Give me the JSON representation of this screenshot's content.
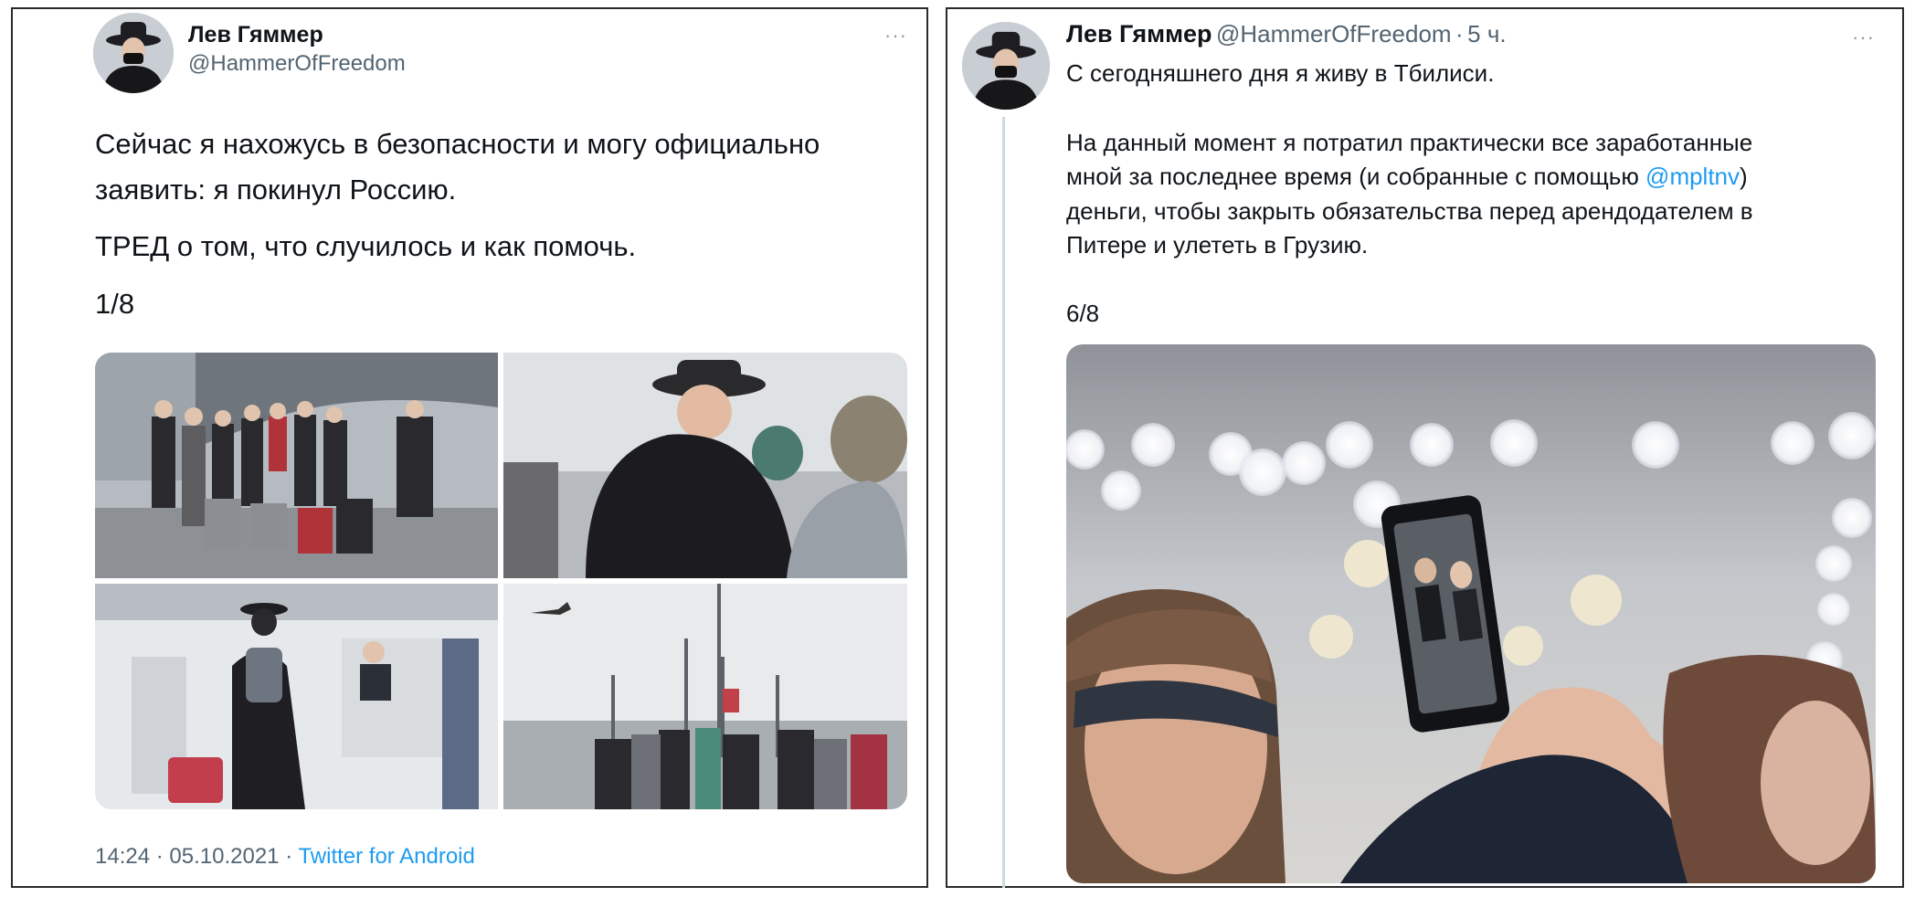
{
  "tweet1": {
    "name": "Лев Гяммер",
    "handle": "@HammerOfFreedom",
    "more": "···",
    "text_line1": "Сейчас я нахожусь в безопасности и могу официально",
    "text_line2": "заявить: я покинул Россию.",
    "text_line3": "ТРЕД о том, что случилось и как помочь.",
    "counter": "1/8",
    "time": "14:24",
    "date": "05.10.2021",
    "separator": "·",
    "source": "Twitter for Android",
    "photos": [
      "group-at-airport-photo",
      "hug-photo",
      "passport-control-photo",
      "departing-plane-photo"
    ]
  },
  "tweet2": {
    "name": "Лев Гяммер",
    "handle": "@HammerOfFreedom",
    "separator": "·",
    "time_ago": "5 ч.",
    "more": "···",
    "line1": "С сегодняшнего дня я живу в Тбилиси.",
    "para_line1": "На данный момент я потратил практически все заработанные",
    "para_line2_a": "мной за последнее время (и собранные с помощью ",
    "mention": "@mpltnv",
    "para_line2_b": ")",
    "para_line3": "деньги, чтобы закрыть обязательства перед арендодателем в",
    "para_line4": "Питере и улететь в Грузию.",
    "counter": "6/8",
    "photo": "phone-selfie-photo"
  },
  "colors": {
    "text": "#0f1419",
    "secondary": "#536471",
    "link": "#1d9bf0",
    "border": "#2b2b2b",
    "thread_line": "#cfd9de"
  }
}
